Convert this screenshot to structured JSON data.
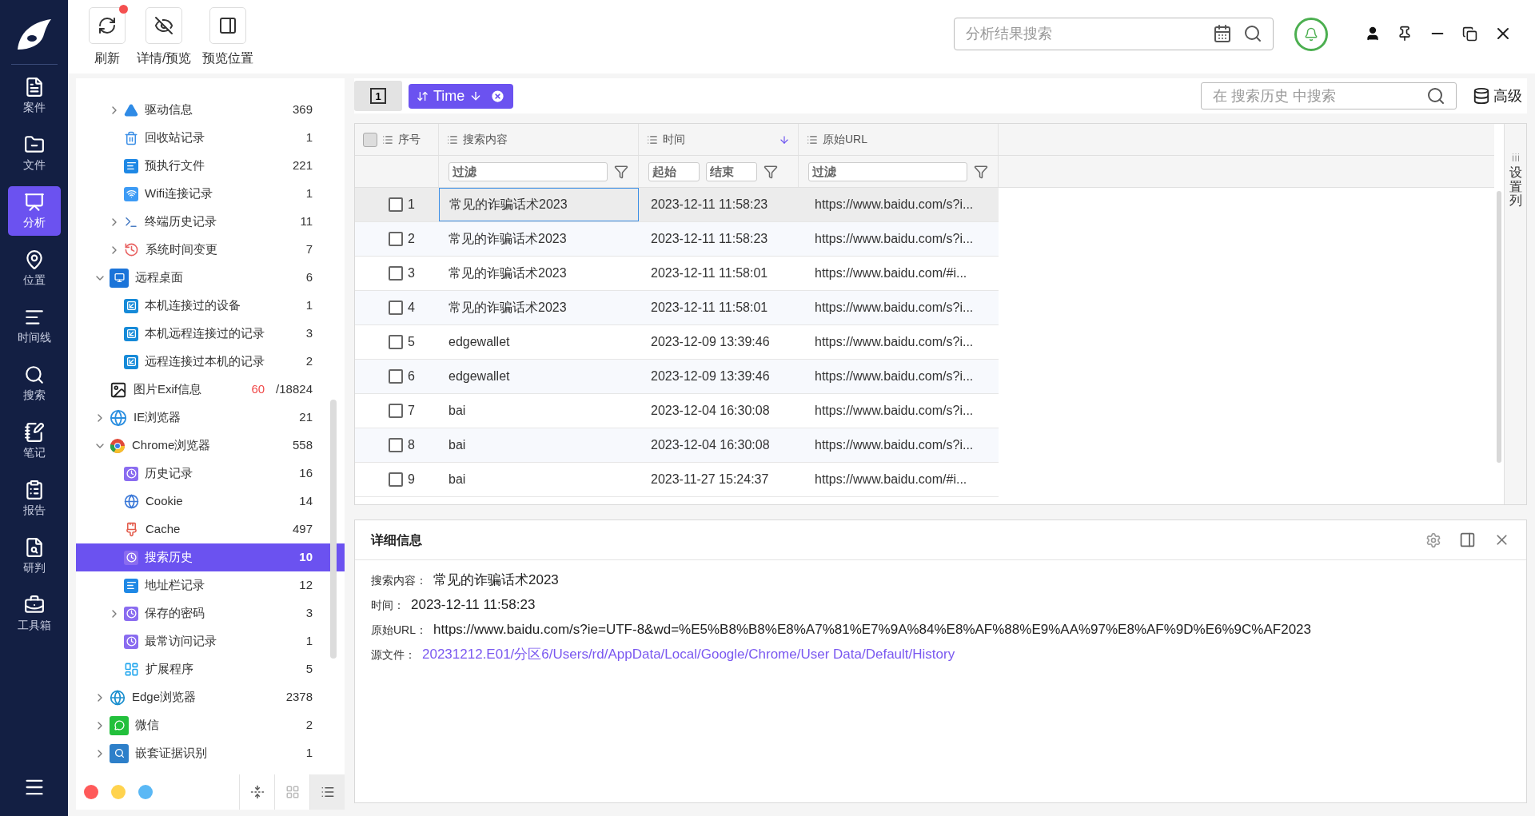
{
  "nav": {
    "items": [
      {
        "label": "案件",
        "kind": "case",
        "selected": false
      },
      {
        "label": "文件",
        "kind": "file",
        "selected": false
      },
      {
        "label": "分析",
        "kind": "analysis",
        "selected": true
      },
      {
        "label": "位置",
        "kind": "location",
        "selected": false
      },
      {
        "label": "时间线",
        "kind": "timeline",
        "selected": false
      },
      {
        "label": "搜索",
        "kind": "search",
        "selected": false
      },
      {
        "label": "笔记",
        "kind": "notes",
        "selected": false
      },
      {
        "label": "报告",
        "kind": "report",
        "selected": false
      },
      {
        "label": "研判",
        "kind": "judge",
        "selected": false
      },
      {
        "label": "工具箱",
        "kind": "toolbox",
        "selected": false
      }
    ]
  },
  "toolbar": [
    {
      "label": "刷新",
      "kind": "refresh",
      "notification": true
    },
    {
      "label": "详情/预览",
      "kind": "preview",
      "notification": false
    },
    {
      "label": "预览位置",
      "kind": "position",
      "notification": false
    }
  ],
  "global_search": {
    "placeholder": "分析结果搜索"
  },
  "tree": {
    "cut_branch": [
      {
        "label": "驱动信息",
        "count": "369",
        "kind": "drive",
        "expanded": false
      },
      {
        "label": "回收站记录",
        "count": "1",
        "kind": "recycle"
      },
      {
        "label": "预执行文件",
        "count": "221",
        "kind": "list"
      },
      {
        "label": "Wifi连接记录",
        "count": "1",
        "kind": "wifi"
      },
      {
        "label": "终端历史记录",
        "count": "11",
        "kind": "terminal",
        "expanded": false
      },
      {
        "label": "系统时间变更",
        "count": "7",
        "kind": "clock",
        "expanded": false
      }
    ],
    "items": [
      {
        "label": "远程桌面",
        "count": "6",
        "kind": "remote",
        "expanded": true,
        "selected": false,
        "children": [
          {
            "label": "本机连接过的设备",
            "count": "1",
            "kind": "link",
            "selected": false
          },
          {
            "label": "本机远程连接过的记录",
            "count": "3",
            "kind": "link",
            "selected": false
          },
          {
            "label": "远程连接过本机的记录",
            "count": "2",
            "kind": "link",
            "selected": false
          }
        ]
      },
      {
        "label": "图片Exif信息",
        "hits": "60",
        "count": "/18824",
        "kind": "image",
        "selected": false
      },
      {
        "label": "IE浏览器",
        "count": "21",
        "kind": "ie",
        "expanded": false,
        "selected": false
      },
      {
        "label": "Chrome浏览器",
        "count": "558",
        "kind": "chrome",
        "expanded": true,
        "selected": false,
        "children": [
          {
            "label": "历史记录",
            "count": "16",
            "kind": "history",
            "selected": false
          },
          {
            "label": "Cookie",
            "count": "14",
            "kind": "globe",
            "selected": false
          },
          {
            "label": "Cache",
            "count": "497",
            "kind": "broom",
            "selected": false
          },
          {
            "label": "搜索历史",
            "count": "10",
            "kind": "history",
            "selected": true
          },
          {
            "label": "地址栏记录",
            "count": "12",
            "kind": "list",
            "selected": false
          },
          {
            "label": "保存的密码",
            "count": "3",
            "kind": "history",
            "expanded": false,
            "selected": false
          },
          {
            "label": "最常访问记录",
            "count": "1",
            "kind": "history",
            "selected": false
          },
          {
            "label": "扩展程序",
            "count": "5",
            "kind": "apps",
            "selected": false
          }
        ]
      },
      {
        "label": "Edge浏览器",
        "count": "2378",
        "kind": "edge",
        "expanded": false,
        "selected": false
      },
      {
        "label": "微信",
        "count": "2",
        "kind": "wechat",
        "expanded": false,
        "selected": false
      },
      {
        "label": "嵌套证据识别",
        "count": "1",
        "kind": "monitor",
        "expanded": false,
        "selected": false
      }
    ],
    "tags": [
      {
        "color": "#ff5a5a"
      },
      {
        "color": "#ffd34e"
      },
      {
        "color": "#5ab8f5"
      }
    ],
    "view_buttons": [
      {
        "kind": "collapse",
        "selected": false
      },
      {
        "kind": "grid",
        "selected": false
      },
      {
        "kind": "list",
        "selected": true
      }
    ]
  },
  "tab_button": {
    "label": "1",
    "selected": true
  },
  "sort_chip": {
    "label": "Time"
  },
  "table_search": {
    "placeholder": "在 搜索历史 中搜索"
  },
  "advanced_button": {
    "label": "高级"
  },
  "table": {
    "columns": [
      {
        "label": "序号",
        "sorted": false
      },
      {
        "label": "搜索内容",
        "sorted": false
      },
      {
        "label": "时间",
        "sorted": true
      },
      {
        "label": "原始URL",
        "sorted": false
      }
    ],
    "filters": [
      {
        "kind": "text",
        "placeholders": [
          "过滤"
        ]
      },
      {
        "kind": "range",
        "placeholders": [
          "起始",
          "结束"
        ]
      },
      {
        "kind": "text",
        "placeholders": [
          "过滤"
        ]
      }
    ],
    "rows": [
      {
        "index": "1",
        "content": "常见的诈骗话术2023",
        "time": "2023-12-11 11:58:23",
        "url": "https://www.baidu.com/s?i...",
        "selected": true,
        "checked": false
      },
      {
        "index": "2",
        "content": "常见的诈骗话术2023",
        "time": "2023-12-11 11:58:23",
        "url": "https://www.baidu.com/s?i...",
        "selected": false,
        "checked": false
      },
      {
        "index": "3",
        "content": "常见的诈骗话术2023",
        "time": "2023-12-11 11:58:01",
        "url": "https://www.baidu.com/#i...",
        "selected": false,
        "checked": false
      },
      {
        "index": "4",
        "content": "常见的诈骗话术2023",
        "time": "2023-12-11 11:58:01",
        "url": "https://www.baidu.com/s?i...",
        "selected": false,
        "checked": false
      },
      {
        "index": "5",
        "content": "edgewallet",
        "time": "2023-12-09 13:39:46",
        "url": "https://www.baidu.com/s?i...",
        "selected": false,
        "checked": false
      },
      {
        "index": "6",
        "content": "edgewallet",
        "time": "2023-12-09 13:39:46",
        "url": "https://www.baidu.com/s?i...",
        "selected": false,
        "checked": false
      },
      {
        "index": "7",
        "content": "bai",
        "time": "2023-12-04 16:30:08",
        "url": "https://www.baidu.com/s?i...",
        "selected": false,
        "checked": false
      },
      {
        "index": "8",
        "content": "bai",
        "time": "2023-12-04 16:30:08",
        "url": "https://www.baidu.com/s?i...",
        "selected": false,
        "checked": false
      },
      {
        "index": "9",
        "content": "bai",
        "time": "2023-11-27 15:24:37",
        "url": "https://www.baidu.com/#i...",
        "selected": false,
        "checked": false
      }
    ],
    "settings_strip": {
      "label": "设置列"
    }
  },
  "detail": {
    "title": "详细信息",
    "fields": [
      {
        "label": "搜索内容：",
        "value": "常见的诈骗话术2023",
        "kind": "text"
      },
      {
        "label": "时间：",
        "value": "2023-12-11 11:58:23",
        "kind": "text"
      },
      {
        "label": "原始URL：",
        "value": "https://www.baidu.com/s?ie=UTF-8&wd=%E5%B8%B8%E8%A7%81%E7%9A%84%E8%AF%88%E9%AA%97%E8%AF%9D%E6%9C%AF2023",
        "kind": "text"
      },
      {
        "label": "源文件：",
        "value": "20231212.E01/分区6/Users/rd/AppData/Local/Google/Chrome/User Data/Default/History",
        "kind": "link"
      }
    ]
  }
}
